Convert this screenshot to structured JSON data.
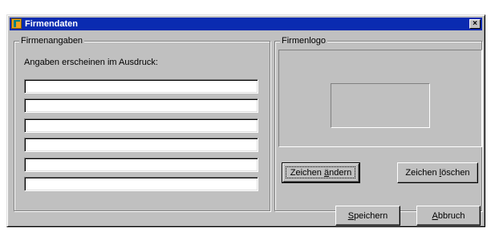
{
  "window": {
    "title": "Firmendaten",
    "close_label": "×"
  },
  "company": {
    "legend": "Firmenangaben",
    "hint": "Angaben erscheinen im Ausdruck:",
    "fields": [
      "",
      "",
      "",
      "",
      "",
      ""
    ]
  },
  "logo": {
    "legend": "Firmenlogo",
    "change_button": {
      "pre": "Zeichen ",
      "accel": "ä",
      "post": "ndern"
    },
    "delete_button": {
      "pre": "Zeichen ",
      "accel": "l",
      "post": "öschen"
    }
  },
  "footer": {
    "save_button": {
      "pre": "",
      "accel": "S",
      "post": "peichern"
    },
    "cancel_button": {
      "pre": "",
      "accel": "A",
      "post": "bbruch"
    }
  }
}
